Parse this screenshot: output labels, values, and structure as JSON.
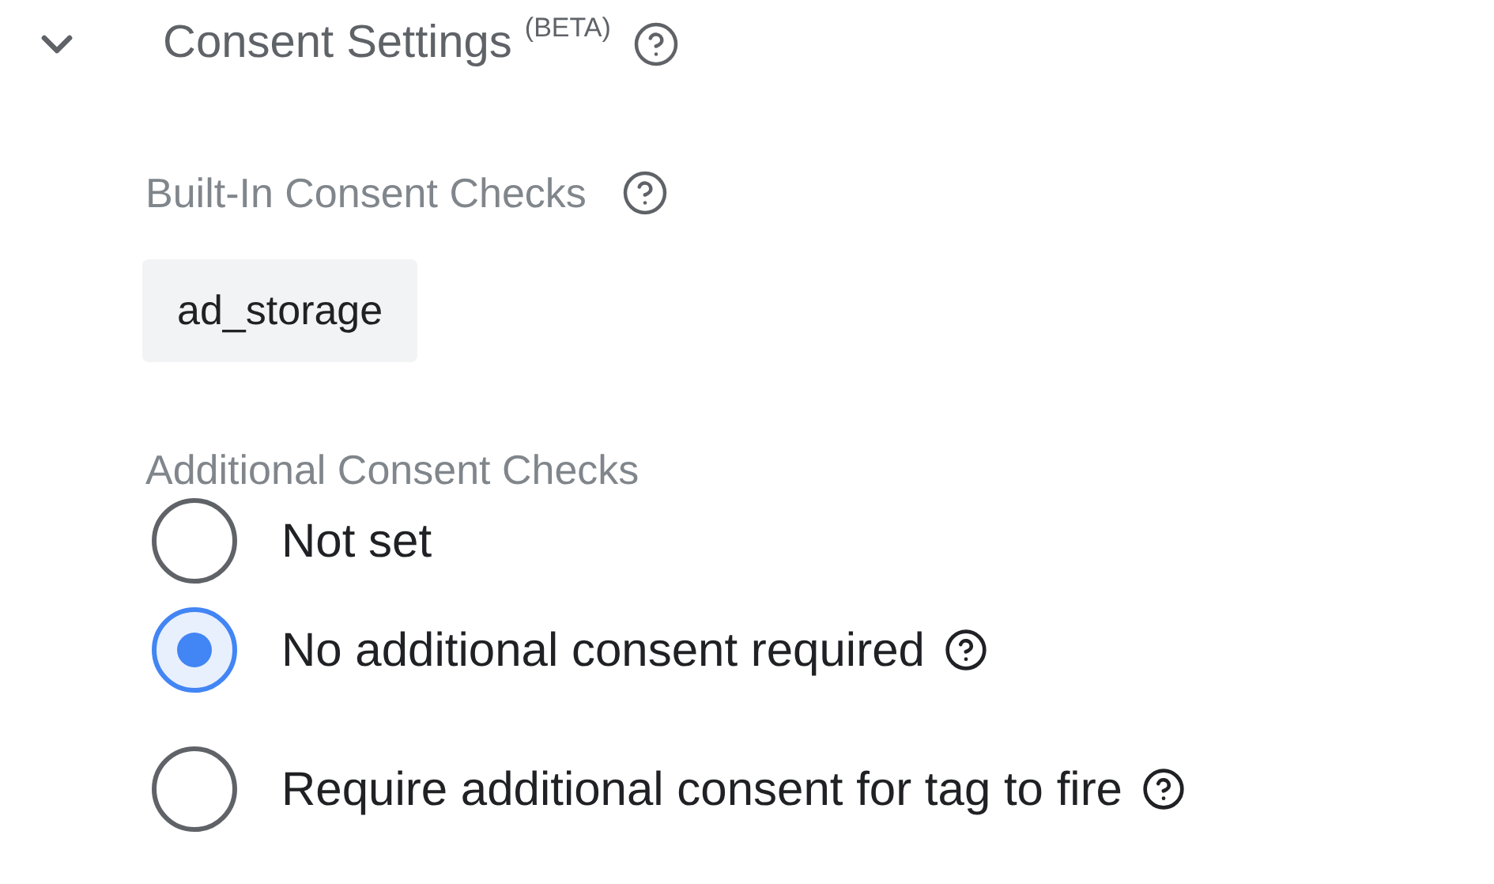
{
  "section": {
    "title": "Consent Settings $^{(BETA)}$",
    "expanded": true
  },
  "built_in": {
    "label": "Built-In Consent Checks",
    "chips": [
      "ad_storage"
    ]
  },
  "additional": {
    "label": "Additional Consent Checks",
    "options": [
      {
        "label": "Not set",
        "selected": false,
        "help": false
      },
      {
        "label": "No additional consent required",
        "selected": true,
        "help": true
      },
      {
        "label": "Require additional consent for tag to fire",
        "selected": false,
        "help": true
      }
    ]
  }
}
